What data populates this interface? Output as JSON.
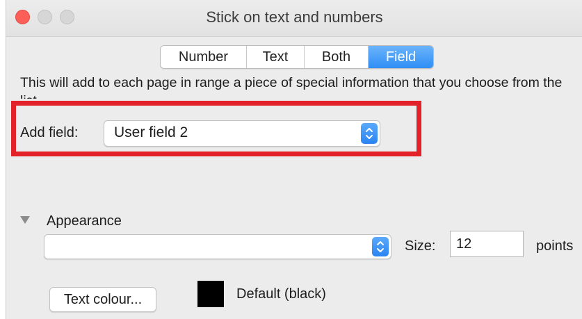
{
  "window": {
    "title": "Stick on text and numbers"
  },
  "tabs": [
    {
      "label": "Number",
      "active": false
    },
    {
      "label": "Text",
      "active": false
    },
    {
      "label": "Both",
      "active": false
    },
    {
      "label": "Field",
      "active": true
    }
  ],
  "description": "This will add to each page in range a piece of special information that you choose from the list",
  "add_field": {
    "label": "Add field:",
    "selected": "User field 2"
  },
  "appearance": {
    "label": "Appearance",
    "font_selected": "",
    "size_label": "Size:",
    "size_value": "12",
    "units_label": "points",
    "text_colour_button": "Text colour...",
    "colour_name": "Default (black)",
    "colour_value": "#000000"
  },
  "colors": {
    "accent": "#2f8ef5",
    "highlight_border": "#e22128",
    "close_button": "#fc5f57"
  },
  "icons": {
    "stepper": "up-down-chevron-icon",
    "disclosure": "disclosure-triangle-icon"
  }
}
